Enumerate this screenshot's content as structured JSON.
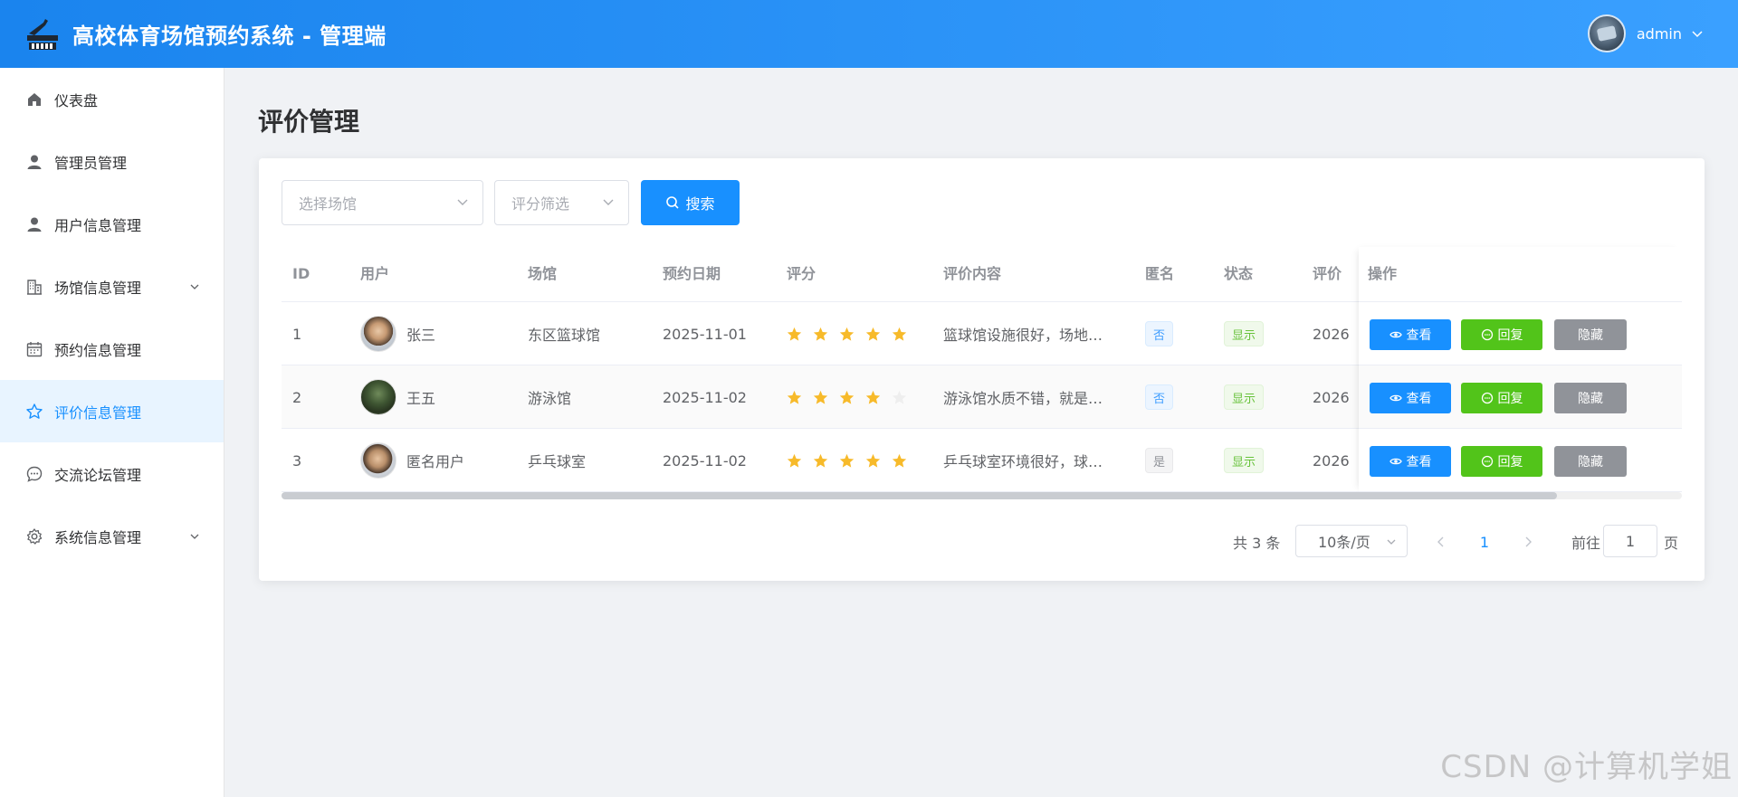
{
  "header": {
    "title": "高校体育场馆预约系统 - 管理端",
    "username": "admin"
  },
  "sidebar": {
    "items": [
      {
        "label": "仪表盘",
        "icon": "home-icon"
      },
      {
        "label": "管理员管理",
        "icon": "user-icon"
      },
      {
        "label": "用户信息管理",
        "icon": "user-icon"
      },
      {
        "label": "场馆信息管理",
        "icon": "building-icon",
        "expandable": true
      },
      {
        "label": "预约信息管理",
        "icon": "calendar-icon"
      },
      {
        "label": "评价信息管理",
        "icon": "star-icon",
        "active": true
      },
      {
        "label": "交流论坛管理",
        "icon": "chat-icon"
      },
      {
        "label": "系统信息管理",
        "icon": "gear-icon",
        "expandable": true
      }
    ]
  },
  "page": {
    "title": "评价管理"
  },
  "filters": {
    "venue_placeholder": "选择场馆",
    "rating_placeholder": "评分筛选",
    "search_label": "搜索"
  },
  "table": {
    "columns": {
      "id": "ID",
      "user": "用户",
      "venue": "场馆",
      "date": "预约日期",
      "rating": "评分",
      "content": "评价内容",
      "anonymous": "匿名",
      "status": "状态",
      "eval_time": "评价",
      "actions": "操作"
    },
    "rows": [
      {
        "id": "1",
        "user": "张三",
        "venue": "东区篮球馆",
        "date": "2025-11-01",
        "rating": 5,
        "content": "篮球馆设施很好，场地…",
        "anonymous": "否",
        "status": "显示",
        "eval_time": "2026"
      },
      {
        "id": "2",
        "user": "王五",
        "venue": "游泳馆",
        "date": "2025-11-02",
        "rating": 4,
        "content": "游泳馆水质不错，就是…",
        "anonymous": "否",
        "status": "显示",
        "eval_time": "2026"
      },
      {
        "id": "3",
        "user": "匿名用户",
        "venue": "乒乓球室",
        "date": "2025-11-02",
        "rating": 5,
        "content": "乒乓球室环境很好，球…",
        "anonymous": "是",
        "status": "显示",
        "eval_time": "2026"
      }
    ],
    "actions": {
      "view": "查看",
      "reply": "回复",
      "hide": "隐藏"
    }
  },
  "pagination": {
    "total_text": "共 3 条",
    "page_size": "10条/页",
    "current_page": "1",
    "goto_prefix": "前往",
    "goto_value": "1",
    "goto_suffix": "页"
  },
  "watermark": "CSDN @计算机学姐",
  "colors": {
    "primary": "#1890ff",
    "success": "#52c41a",
    "muted": "#909399",
    "star": "#f7ba2a"
  }
}
